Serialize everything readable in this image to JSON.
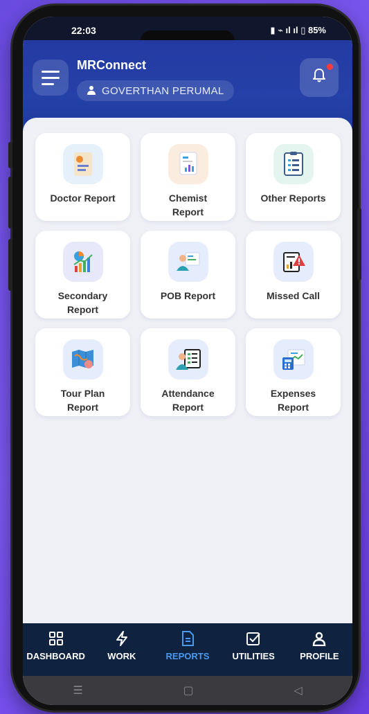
{
  "status": {
    "time": "22:03",
    "right_text": "85%"
  },
  "header": {
    "app_title": "MRConnect",
    "user_name": "GOVERTHAN PERUMAL"
  },
  "tiles": [
    {
      "label": "Doctor Report",
      "icon": "doctor-report-icon"
    },
    {
      "label": "Chemist\nReport",
      "icon": "chemist-report-icon"
    },
    {
      "label": "Other Reports",
      "icon": "other-reports-icon"
    },
    {
      "label": "Secondary\nReport",
      "icon": "secondary-report-icon"
    },
    {
      "label": "POB Report",
      "icon": "pob-report-icon"
    },
    {
      "label": "Missed Call",
      "icon": "missed-call-icon"
    },
    {
      "label": "Tour Plan\nReport",
      "icon": "tour-plan-icon"
    },
    {
      "label": "Attendance\nReport",
      "icon": "attendance-icon"
    },
    {
      "label": "Expenses\nReport",
      "icon": "expenses-icon"
    }
  ],
  "nav": [
    {
      "label": "DASHBOARD",
      "icon": "grid-icon"
    },
    {
      "label": "WORK",
      "icon": "lightning-icon"
    },
    {
      "label": "REPORTS",
      "icon": "document-icon"
    },
    {
      "label": "UTILITIES",
      "icon": "checkbox-icon"
    },
    {
      "label": "PROFILE",
      "icon": "person-icon"
    }
  ],
  "active_nav": "REPORTS",
  "colors": {
    "header": "#243aa3",
    "nav_bg": "#0f2240",
    "accent": "#4a9bf0"
  }
}
